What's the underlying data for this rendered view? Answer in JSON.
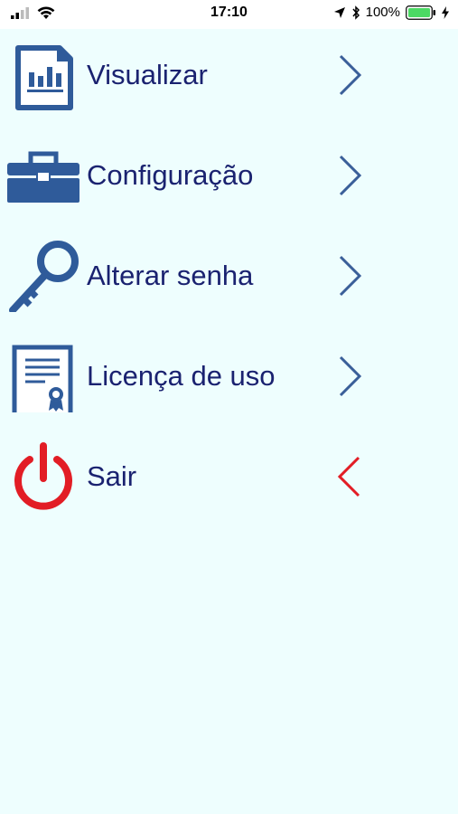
{
  "status_bar": {
    "time": "17:10",
    "battery_percent": "100%"
  },
  "menu": {
    "items": [
      {
        "label": "Visualizar",
        "icon": "report-chart-icon"
      },
      {
        "label": "Configuração",
        "icon": "toolbox-icon"
      },
      {
        "label": "Alterar senha",
        "icon": "key-icon"
      },
      {
        "label": "Licença de uso",
        "icon": "certificate-icon"
      },
      {
        "label": "Sair",
        "icon": "power-icon"
      }
    ]
  },
  "colors": {
    "background": "#eefefe",
    "label": "#1a2270",
    "icon_blue": "#2f5b9a",
    "chevron_blue": "#3a5f99",
    "exit_red": "#e21d25",
    "battery_green": "#4cd964"
  }
}
